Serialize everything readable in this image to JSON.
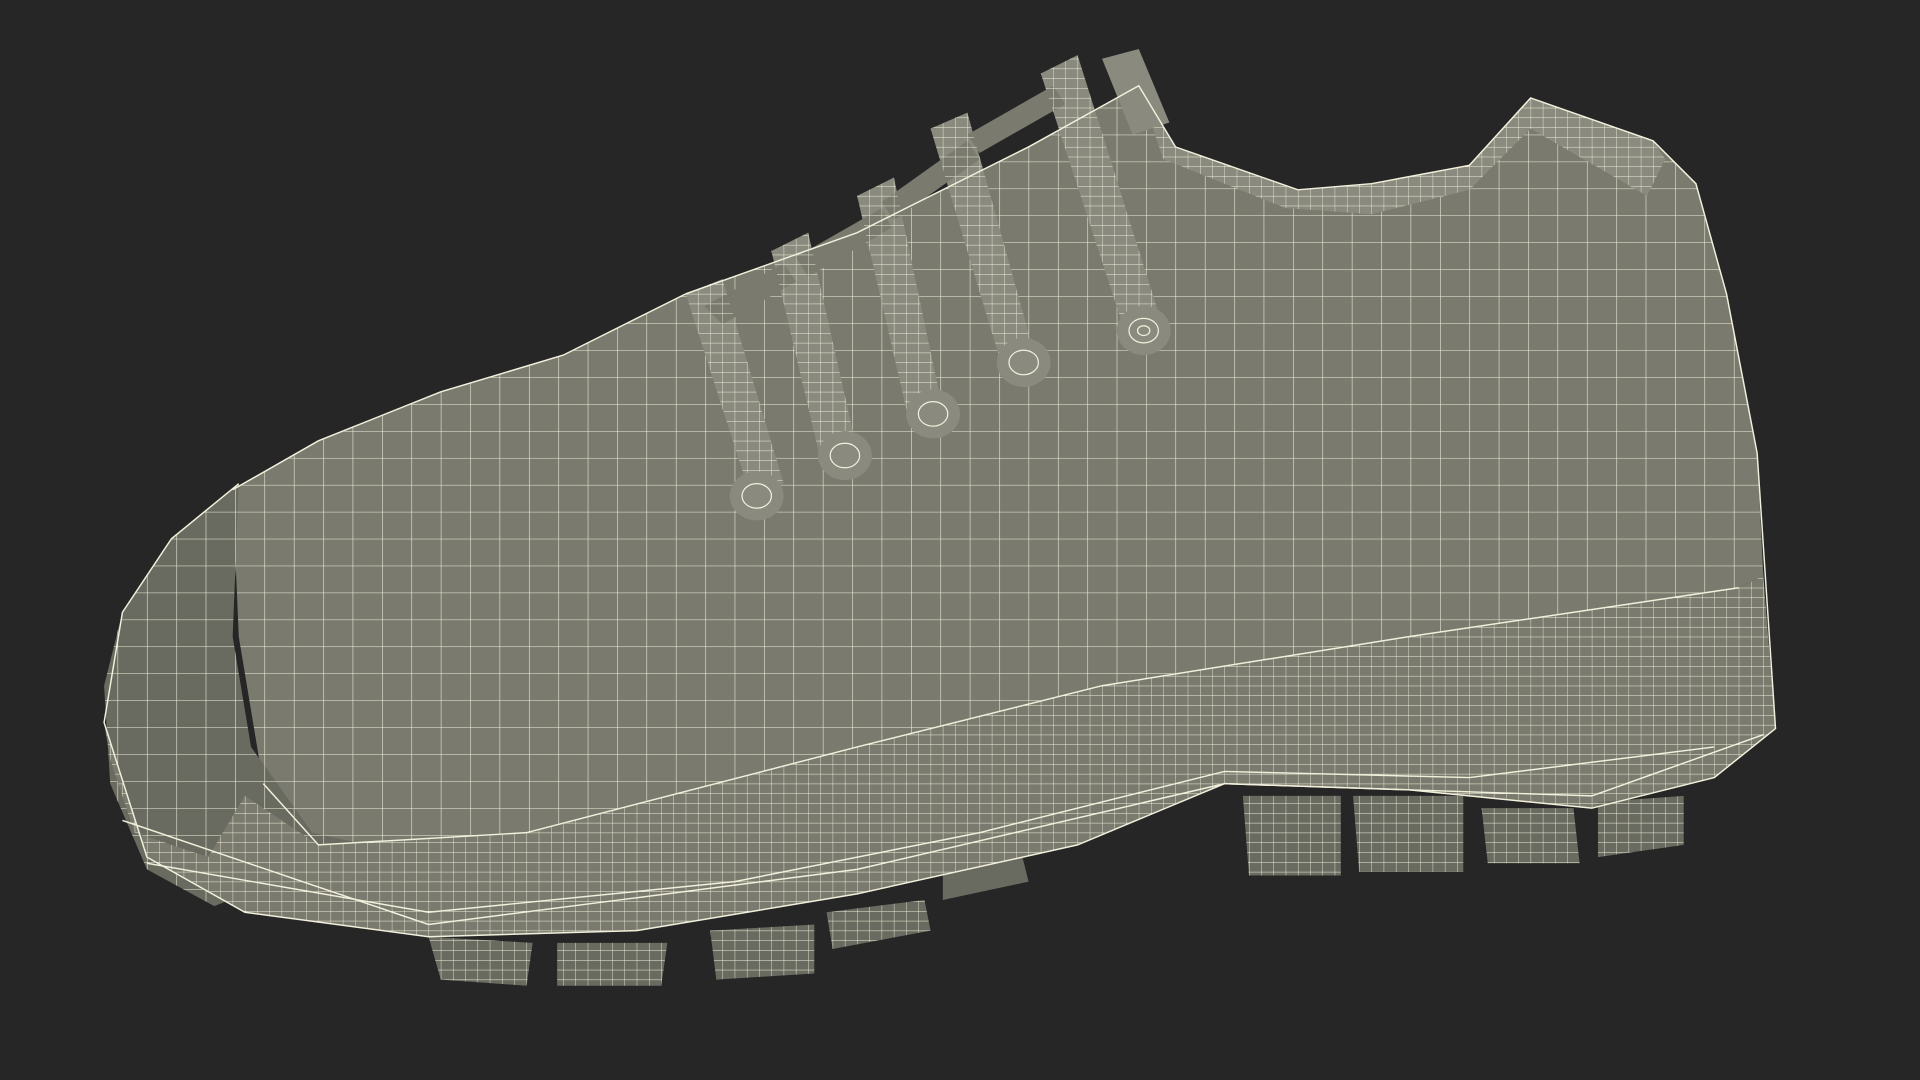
{
  "scene": {
    "subject": "shoe-wireframe",
    "colors": {
      "background": "#262626",
      "surface": "#7a7b6e",
      "surface_dark": "#6a6b60",
      "surface_light": "#8a8b7e",
      "interior": "#1c1d1a",
      "wire": "#f2f0dc"
    }
  }
}
